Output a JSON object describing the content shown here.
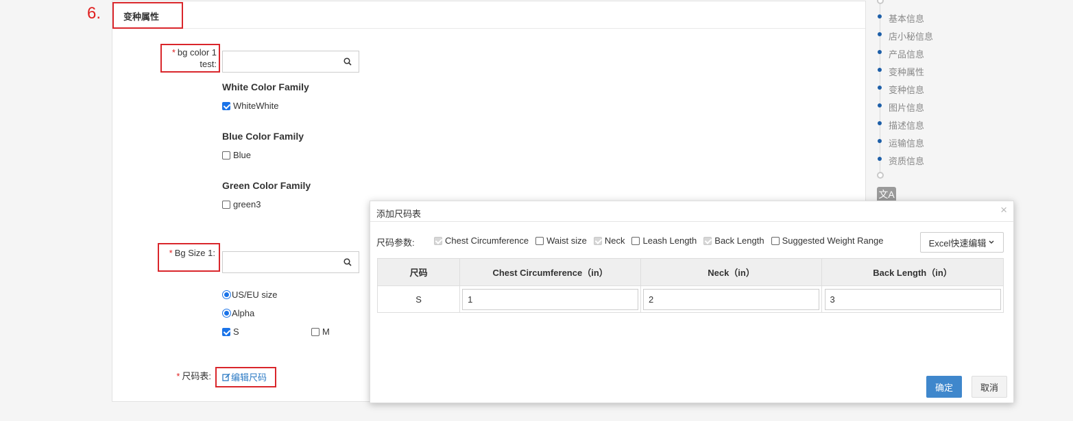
{
  "annotation": {
    "step": "6."
  },
  "section": {
    "title": "变种属性"
  },
  "color_field": {
    "label_line1": "bg color 1",
    "label_line2": "test:",
    "required_mark": "*",
    "groups": [
      {
        "title": "White Color Family",
        "options": [
          {
            "label": "WhiteWhite",
            "checked": true
          }
        ]
      },
      {
        "title": "Blue Color Family",
        "options": [
          {
            "label": "Blue",
            "checked": false
          }
        ]
      },
      {
        "title": "Green Color Family",
        "options": [
          {
            "label": "green3",
            "checked": false
          }
        ]
      }
    ]
  },
  "size_field": {
    "label": "Bg Size 1:",
    "required_mark": "*",
    "radios": [
      {
        "label": "US/EU size",
        "checked": true
      },
      {
        "label": "Alpha",
        "checked": true
      }
    ],
    "options": [
      {
        "label": "S",
        "checked": true
      },
      {
        "label": "M",
        "checked": false
      }
    ]
  },
  "size_chart_field": {
    "label": "尺码表:",
    "required_mark": "*",
    "edit_link": "编辑尺码"
  },
  "nav": {
    "items": [
      "基本信息",
      "店小秘信息",
      "产品信息",
      "变种属性",
      "变种信息",
      "图片信息",
      "描述信息",
      "运输信息",
      "资质信息"
    ],
    "translate_icon": "文A"
  },
  "modal": {
    "title": "添加尺码表",
    "close": "×",
    "param_label": "尺码参数:",
    "params": [
      {
        "label": "Chest Circumference",
        "state": "disabled-checked"
      },
      {
        "label": "Waist size",
        "state": "unchecked"
      },
      {
        "label": "Neck",
        "state": "disabled-checked"
      },
      {
        "label": "Leash Length",
        "state": "unchecked"
      },
      {
        "label": "Back Length",
        "state": "disabled-checked"
      },
      {
        "label": "Suggested Weight Range",
        "state": "unchecked"
      }
    ],
    "excel_button": "Excel快速编辑",
    "table": {
      "headers": [
        "尺码",
        "Chest Circumference（in）",
        "Neck（in）",
        "Back Length（in）"
      ],
      "rows": [
        {
          "size": "S",
          "values": [
            "1",
            "2",
            "3"
          ]
        }
      ]
    },
    "ok": "确定",
    "cancel": "取消"
  },
  "colors": {
    "accent": "#1a73e8",
    "primary_button": "#3f87cc",
    "annotation_red": "#d9252a",
    "link": "#2b7ac4"
  }
}
